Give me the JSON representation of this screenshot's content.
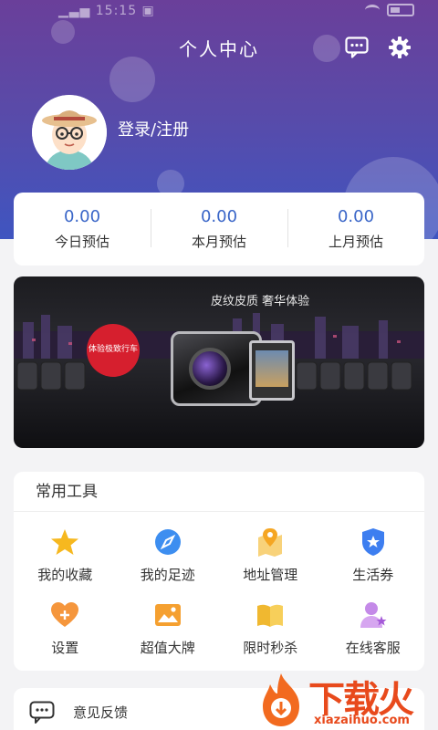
{
  "status_bar": {
    "left": "▁▃▅ 15:15 ▣",
    "battery": "61"
  },
  "header": {
    "title": "个人中心",
    "login_text": "登录/注册"
  },
  "stats": [
    {
      "value": "0.00",
      "label": "今日预估"
    },
    {
      "value": "0.00",
      "label": "本月预估"
    },
    {
      "value": "0.00",
      "label": "上月预估"
    }
  ],
  "banner": {
    "slogan": "皮纹皮质 奢华体验",
    "badge": "体验极致行车"
  },
  "tools": {
    "heading": "常用工具",
    "items": [
      {
        "label": "我的收藏",
        "icon": "star-icon",
        "color": "#f6b81f"
      },
      {
        "label": "我的足迹",
        "icon": "compass-icon",
        "color": "#3d8ef0"
      },
      {
        "label": "地址管理",
        "icon": "map-icon",
        "color": "#f5b530"
      },
      {
        "label": "生活券",
        "icon": "ticket-icon",
        "color": "#3d7ef0"
      },
      {
        "label": "设置",
        "icon": "heart-plus-icon",
        "color": "#f5963c"
      },
      {
        "label": "超值大牌",
        "icon": "picture-icon",
        "color": "#f5a030"
      },
      {
        "label": "限时秒杀",
        "icon": "book-icon",
        "color": "#f0b830"
      },
      {
        "label": "在线客服",
        "icon": "customer-service-icon",
        "color": "#c48ae8"
      }
    ]
  },
  "feedback": {
    "label": "意见反馈"
  },
  "watermark": {
    "main": "下载火",
    "sub": "xiazaihuo.com"
  }
}
